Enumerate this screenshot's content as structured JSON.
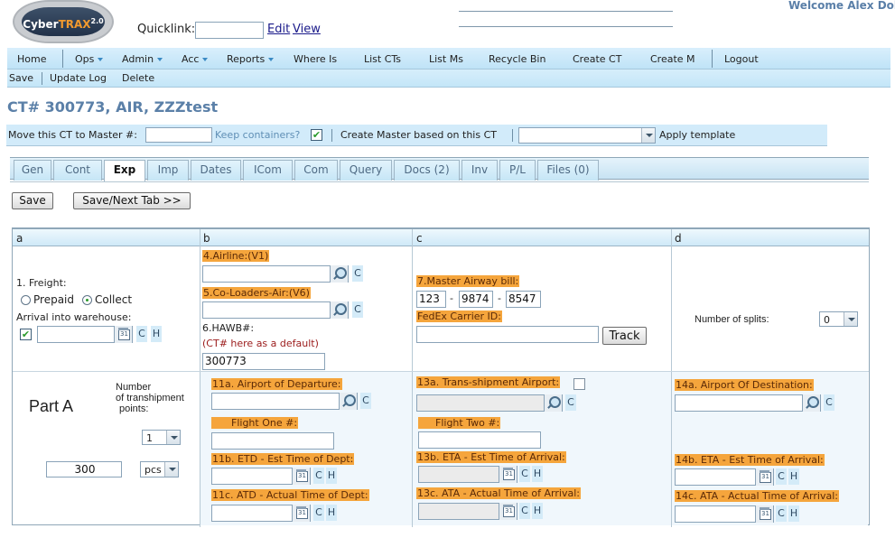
{
  "header": {
    "logo_text_1": "Cyber",
    "logo_text_2": "TRAX",
    "logo_version": "2.0",
    "quicklink_label": "Quicklink:",
    "quicklink_value": "",
    "edit_link": "Edit",
    "view_link": "View",
    "welcome": "Welcome Alex Dol"
  },
  "nav": {
    "items": [
      {
        "label": "Home"
      },
      {
        "label": "Ops"
      },
      {
        "label": "Admin"
      },
      {
        "label": "Acc"
      },
      {
        "label": "Reports"
      },
      {
        "label": "Where Is"
      },
      {
        "label": "List CTs"
      },
      {
        "label": "List Ms"
      },
      {
        "label": "Recycle Bin"
      },
      {
        "label": "Create CT"
      },
      {
        "label": "Create M"
      },
      {
        "label": "Logout"
      }
    ]
  },
  "subnav": {
    "save": "Save",
    "update_log": "Update Log",
    "delete": "Delete"
  },
  "page_title": "CT# 300773, AIR, ZZZtest",
  "movebar": {
    "move_label": "Move this CT to Master #:",
    "move_value": "",
    "keep_containers": "Keep containers?",
    "keep_checked": "✔",
    "create_master": "Create Master based on this CT",
    "template_value": "",
    "apply_template": "Apply template"
  },
  "tabs": [
    {
      "label": "Gen"
    },
    {
      "label": "Cont"
    },
    {
      "label": "Exp"
    },
    {
      "label": "Imp"
    },
    {
      "label": "Dates"
    },
    {
      "label": "ICom"
    },
    {
      "label": "Com"
    },
    {
      "label": "Query"
    },
    {
      "label": "Docs (2)"
    },
    {
      "label": "Inv"
    },
    {
      "label": "P/L"
    },
    {
      "label": "Files (0)"
    }
  ],
  "active_tab": "Exp",
  "buttons": {
    "save": "Save",
    "save_next": "Save/Next Tab >>",
    "track": "Track"
  },
  "grid": {
    "columns": [
      "a",
      "b",
      "c",
      "d"
    ],
    "freight_label": "1. Freight:",
    "prepaid": "Prepaid",
    "collect": "Collect",
    "freight_selected": "Collect",
    "arrival_label": "Arrival into warehouse:",
    "arrival_checked": "✔",
    "airline_label": "4.Airline:(V1)",
    "coloaders_label": "5.Co-Loaders-Air:(V6)",
    "hawb_label": "6.HAWB#:",
    "hawb_hint": "(CT# here as a default)",
    "hawb_value": "300773",
    "mawb_label": "7.Master Airway bill:",
    "mawb_1": "123",
    "mawb_2": "9874",
    "mawb_3": "8547",
    "fedex_label": "FedEx Carrier ID:",
    "fedex_value": "",
    "splits_label": "Number of splits:",
    "splits_value": "0",
    "part_a": "Part A",
    "transhipment_label_1": "Number",
    "transhipment_label_2": "of transhipment",
    "transhipment_label_3": "points:",
    "transhipment_value": "1",
    "pieces_value": "300",
    "pieces_unit": "pcs",
    "dep_airport_label": "11a. Airport of Departure:",
    "flight_one_label": "Flight One #:",
    "etd_label": "11b. ETD - Est Time of Dept:",
    "atd_label": "11c. ATD - Actual Time of Dept:",
    "trans_airport_label": "13a. Trans-shipment Airport:",
    "flight_two_label": "Flight Two #:",
    "eta13_label": "13b. ETA - Est Time of Arrival:",
    "ata13_label": "13c. ATA - Actual Time of Arrival:",
    "dest_airport_label": "14a. Airport Of Destination:",
    "eta14_label": "14b. ETA - Est Time of Arrival:",
    "ata14_label": "14c. ATA - Actual Time of Arrival:",
    "c": "C",
    "h": "H"
  }
}
